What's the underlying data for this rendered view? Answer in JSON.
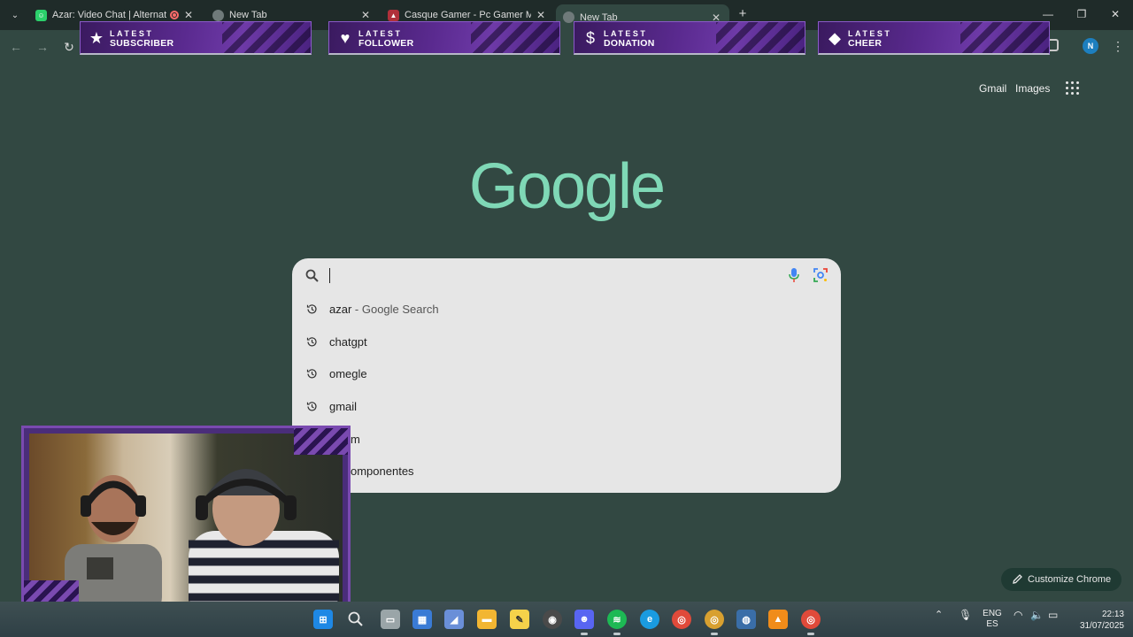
{
  "tabs": [
    {
      "title": "Azar: Video Chat | Alternativ",
      "active": false,
      "favicon": "azar-icon",
      "recording": true
    },
    {
      "title": "New Tab",
      "active": false,
      "favicon": "chrome-icon"
    },
    {
      "title": "Casque Gamer - Pc Gamer Mar",
      "active": false,
      "favicon": "shop-icon"
    },
    {
      "title": "New Tab",
      "active": true,
      "favicon": "chrome-icon"
    }
  ],
  "alerts": [
    {
      "small": "LATEST",
      "big": "SUBSCRIBER",
      "icon": "★"
    },
    {
      "small": "LATEST",
      "big": "FOLLOWER",
      "icon": "♥"
    },
    {
      "small": "LATEST",
      "big": "DONATION",
      "icon": "$"
    },
    {
      "small": "LATEST",
      "big": "CHEER",
      "icon": "◆"
    }
  ],
  "profile": {
    "initial": "N"
  },
  "google": {
    "logo": "Google",
    "gmail": "Gmail",
    "images": "Images",
    "search_value": "",
    "suggestions": [
      {
        "main": "azar",
        "extra": " - Google Search"
      },
      {
        "main": "chatgpt",
        "extra": ""
      },
      {
        "main": "omegle",
        "extra": ""
      },
      {
        "main": "gmail",
        "extra": ""
      },
      {
        "main": "m",
        "extra": ""
      },
      {
        "main": "omponentes",
        "extra": ""
      }
    ],
    "customize": "Customize Chrome"
  },
  "tray": {
    "lang1": "ENG",
    "lang2": "ES",
    "time": "22:13",
    "date": "31/07/2025"
  },
  "colors": {
    "accent": "#7fd8b6",
    "background": "#324842",
    "alert_purple": "#5a2a8f"
  }
}
